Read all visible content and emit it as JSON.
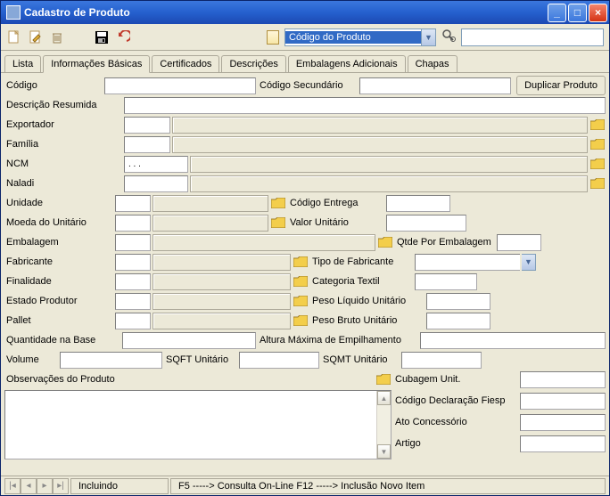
{
  "window": {
    "title": "Cadastro de Produto"
  },
  "toolbar": {
    "search_combo_selected": "Código do Produto",
    "search_value": ""
  },
  "tabs": [
    "Lista",
    "Informações Básicas",
    "Certificados",
    "Descrições",
    "Embalagens Adicionais",
    "Chapas"
  ],
  "active_tab": 1,
  "topbar": {
    "codigo_label": "Código",
    "codigo_sec_label": "Código Secundário",
    "dup_button": "Duplicar Produto"
  },
  "labels": {
    "descricao": "Descrição Resumida",
    "exportador": "Exportador",
    "familia": "Família",
    "ncm": "NCM",
    "naladi": "Naladi",
    "unidade": "Unidade",
    "cod_entrega": "Código Entrega",
    "moeda": "Moeda do Unitário",
    "valor_unit": "Valor Unitário",
    "embalagem": "Embalagem",
    "qtde_emb": "Qtde Por Embalagem",
    "fabricante": "Fabricante",
    "tipo_fab": "Tipo de Fabricante",
    "finalidade": "Finalidade",
    "categoria": "Categoria Textil",
    "estado": "Estado Produtor",
    "peso_liq": "Peso Líquido Unitário",
    "pallet": "Pallet",
    "peso_bruto": "Peso Bruto Unitário",
    "qtd_base": "Quantidade na Base",
    "alt_max": "Altura Máxima de Empilhamento",
    "volume": "Volume",
    "sqft": "SQFT Unitário",
    "sqmt": "SQMT Unitário",
    "obs": "Observações do Produto",
    "cubagem": "Cubagem Unit.",
    "fiesp": "Código Declaração Fiesp",
    "ato": "Ato Concessório",
    "artigo": "Artigo"
  },
  "values": {
    "ncm": ".     .     .",
    "naladi": " "
  },
  "status": {
    "mode": "Incluindo",
    "help": "F5   -----> Consulta On-Line  F12 -----> Inclusão Novo Item"
  }
}
